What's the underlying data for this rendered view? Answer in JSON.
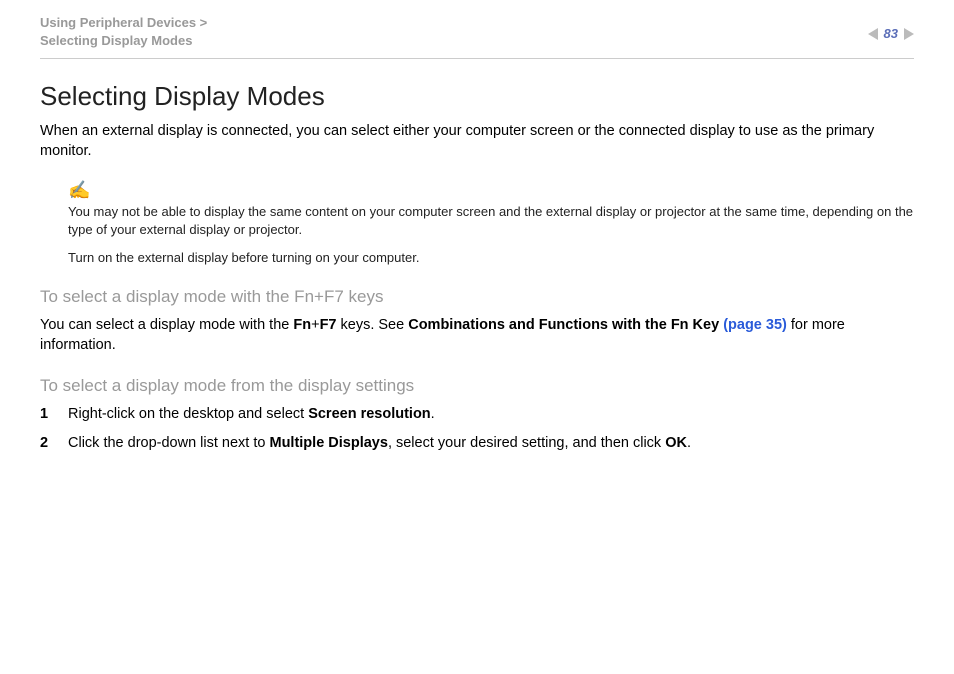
{
  "header": {
    "breadcrumb_parent": "Using Peripheral Devices >",
    "breadcrumb_current": "Selecting Display Modes",
    "page_number": "83"
  },
  "title": "Selecting Display Modes",
  "intro": "When an external display is connected, you can select either your computer screen or the connected display to use as the primary monitor.",
  "note": {
    "line1": "You may not be able to display the same content on your computer screen and the external display or projector at the same time, depending on the type of your external display or projector.",
    "line2": "Turn on the external display before turning on your computer."
  },
  "section1": {
    "heading": "To select a display mode with the Fn+F7 keys",
    "text_pre": "You can select a display mode with the ",
    "fn": "Fn",
    "plus": "+",
    "f7": "F7",
    "text_mid": " keys. See ",
    "ref_label": "Combinations and Functions with the Fn Key",
    "ref_page": " (page 35)",
    "text_post": " for more information."
  },
  "section2": {
    "heading": "To select a display mode from the display settings",
    "step1_pre": "Right-click on the desktop and select ",
    "step1_bold": "Screen resolution",
    "step1_post": ".",
    "step2_pre": "Click the drop-down list next to ",
    "step2_bold1": "Multiple Displays",
    "step2_mid": ", select your desired setting, and then click ",
    "step2_bold2": "OK",
    "step2_post": "."
  }
}
